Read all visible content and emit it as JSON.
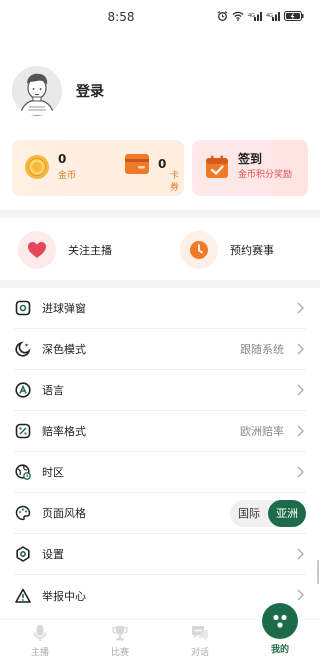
{
  "status_bar": {
    "time": "8:58"
  },
  "profile": {
    "login_label": "登录"
  },
  "wallet": {
    "coin_value": "0",
    "coin_label": "金币",
    "card_value": "0",
    "card_label": "卡券"
  },
  "checkin": {
    "title": "签到",
    "subtitle": "金币积分奖励"
  },
  "quick_actions": {
    "follow_label": "关注主播",
    "reserve_label": "预约赛事"
  },
  "settings": {
    "goal_popup": "进球弹窗",
    "dark_mode": "深色模式",
    "dark_mode_value": "跟随系统",
    "language": "语言",
    "odds_format": "赔率格式",
    "odds_format_value": "欧洲赔率",
    "timezone": "时区",
    "page_style": "页面风格",
    "page_style_options": [
      "国际",
      "亚洲"
    ],
    "page_style_selected": "亚洲",
    "settings": "设置",
    "report_center": "举报中心"
  },
  "bottom_nav": {
    "items": [
      {
        "label": "主播",
        "icon": "microphone-icon"
      },
      {
        "label": "比赛",
        "icon": "trophy-icon"
      },
      {
        "label": "对话",
        "icon": "chat-icon"
      },
      {
        "label": "我的",
        "icon": "mine-face-icon"
      }
    ],
    "active": "我的"
  },
  "colors": {
    "accent_green": "#1e6b4a",
    "coin_orange": "#e07a2e",
    "heart_red": "#e8455a",
    "checkin_red": "#e05050"
  }
}
